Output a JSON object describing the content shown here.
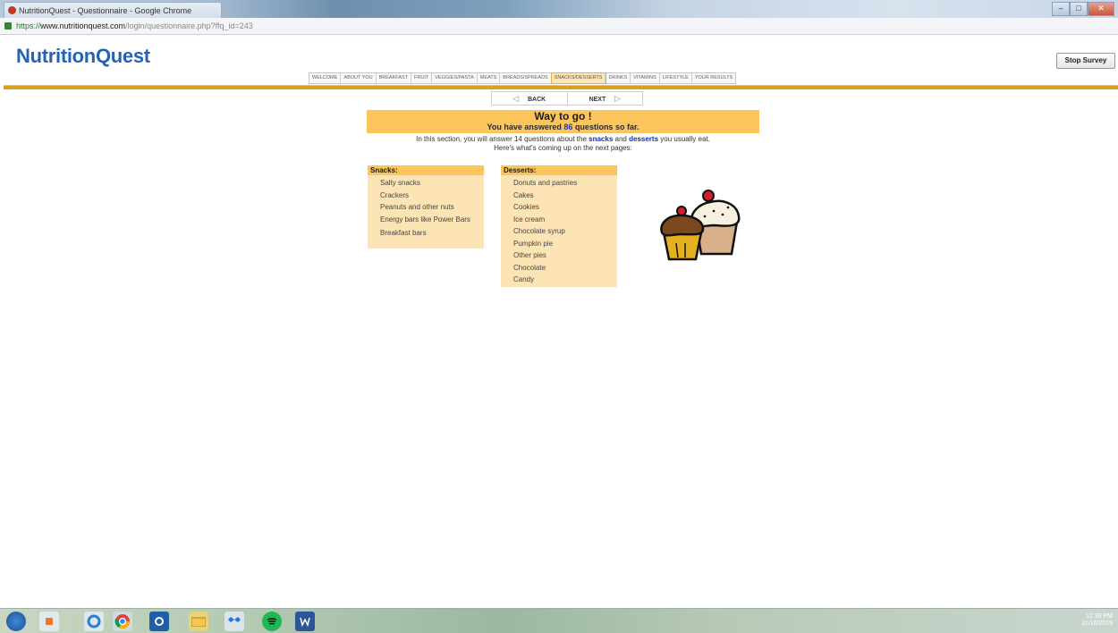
{
  "browser": {
    "tab_title": "NutritionQuest - Questionnaire - Google Chrome",
    "url_scheme": "https://",
    "url_host": "www.nutritionquest.com",
    "url_path": "/login/questionnaire.php?ffq_id=243",
    "min_symbol": "–",
    "max_symbol": "□",
    "close_symbol": "✕"
  },
  "header": {
    "logo": "NutritionQuest",
    "stop_button": "Stop Survey"
  },
  "nav": {
    "items": [
      "WELCOME",
      "ABOUT YOU",
      "BREAKFAST",
      "FRUIT",
      "VEGGIES/PASTA",
      "MEATS",
      "BREADS/SPREADS",
      "SNACKS/DESSERTS",
      "DRINKS",
      "VITAMINS",
      "LIFESTYLE",
      "YOUR RESULTS"
    ],
    "active_index": 7
  },
  "pager": {
    "back": "BACK",
    "next": "NEXT",
    "back_arrow": "◁",
    "next_arrow": "▷"
  },
  "banner": {
    "title": "Way to go !",
    "answered_prefix": "You have answered",
    "answered_count": "86",
    "answered_suffix": "questions so far."
  },
  "intro": {
    "line1_a": "In this section, you will answer 14 questions about the",
    "snacks_word": "snacks",
    "and_word": "and",
    "desserts_word": "desserts",
    "line1_b": "you usually eat.",
    "line2": "Here's what's coming up on the next pages:"
  },
  "snacks": {
    "heading": "Snacks:",
    "items": [
      "Salty snacks",
      "Crackers",
      "Peanuts and other nuts",
      "Energy bars like Power Bars",
      "Breakfast bars"
    ]
  },
  "desserts": {
    "heading": "Desserts:",
    "items": [
      "Donuts and pastries",
      "Cakes",
      "Cookies",
      "Ice cream",
      "Chocolate syrup",
      "Pumpkin pie",
      "Other pies",
      "Chocolate",
      "Candy"
    ]
  },
  "taskbar": {
    "time": "12:39 PM",
    "date": "11/16/2015"
  },
  "colors": {
    "brand_blue": "#2462b8",
    "gold": "#fbc55b",
    "gold_rule": "#d8a21c",
    "panel_light": "#fde4b4"
  }
}
